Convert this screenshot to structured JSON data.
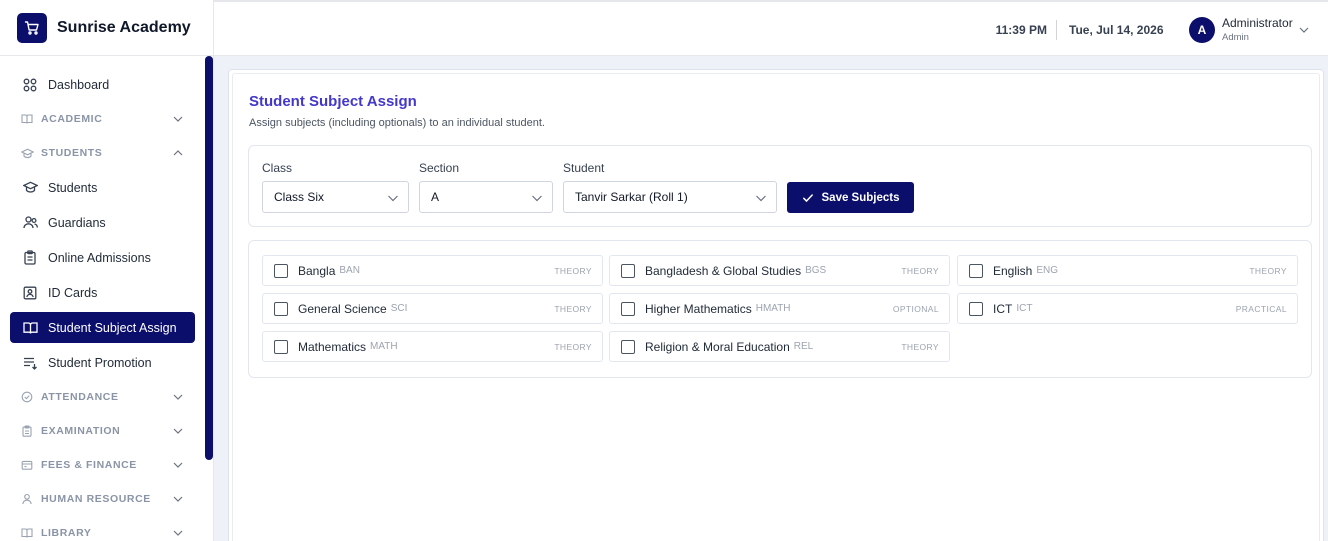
{
  "brand": {
    "name": "Sunrise Academy"
  },
  "sidebar": {
    "items": [
      {
        "label": "Dashboard",
        "icon": "grid-icon"
      },
      {
        "label": "ACADEMIC",
        "icon": "book-icon",
        "section": true,
        "expanded": false
      },
      {
        "label": "STUDENTS",
        "icon": "graduation-cap-icon",
        "section": true,
        "expanded": true
      },
      {
        "label": "Students",
        "icon": "graduation-cap-icon"
      },
      {
        "label": "Guardians",
        "icon": "users-icon"
      },
      {
        "label": "Online Admissions",
        "icon": "clipboard-icon"
      },
      {
        "label": "ID Cards",
        "icon": "id-card-icon"
      },
      {
        "label": "Student Subject Assign",
        "icon": "open-book-icon",
        "active": true
      },
      {
        "label": "Student Promotion",
        "icon": "list-arrow-icon"
      },
      {
        "label": "ATTENDANCE",
        "icon": "shield-check-icon",
        "section": true,
        "expanded": false
      },
      {
        "label": "EXAMINATION",
        "icon": "clipboard-icon",
        "section": true,
        "expanded": false
      },
      {
        "label": "FEES & FINANCE",
        "icon": "wallet-icon",
        "section": true,
        "expanded": false
      },
      {
        "label": "HUMAN RESOURCE",
        "icon": "user-icon",
        "section": true,
        "expanded": false
      },
      {
        "label": "LIBRARY",
        "icon": "book-icon",
        "section": true,
        "expanded": false
      }
    ]
  },
  "header": {
    "time": "11:39 PM",
    "date": "Tue, Jul 14, 2026",
    "avatar_initial": "A",
    "user_name": "Administrator",
    "user_role": "Admin"
  },
  "page": {
    "title": "Student Subject Assign",
    "subtitle": "Assign subjects (including optionals) to an individual student."
  },
  "filters": {
    "class_label": "Class",
    "class_value": "Class Six",
    "section_label": "Section",
    "section_value": "A",
    "student_label": "Student",
    "student_value": "Tanvir Sarkar (Roll 1)",
    "save_label": "Save Subjects"
  },
  "subjects": [
    {
      "name": "Bangla",
      "code": "BAN",
      "type": "THEORY",
      "checked": false
    },
    {
      "name": "Bangladesh & Global Studies",
      "code": "BGS",
      "type": "THEORY",
      "checked": false
    },
    {
      "name": "English",
      "code": "ENG",
      "type": "THEORY",
      "checked": false
    },
    {
      "name": "General Science",
      "code": "SCI",
      "type": "THEORY",
      "checked": false
    },
    {
      "name": "Higher Mathematics",
      "code": "HMATH",
      "type": "OPTIONAL",
      "checked": false
    },
    {
      "name": "ICT",
      "code": "ICT",
      "type": "PRACTICAL",
      "checked": false
    },
    {
      "name": "Mathematics",
      "code": "MATH",
      "type": "THEORY",
      "checked": false
    },
    {
      "name": "Religion & Moral Education",
      "code": "REL",
      "type": "THEORY",
      "checked": false
    }
  ],
  "colors": {
    "brand": "#0b0f6b",
    "title": "#4338ca"
  }
}
